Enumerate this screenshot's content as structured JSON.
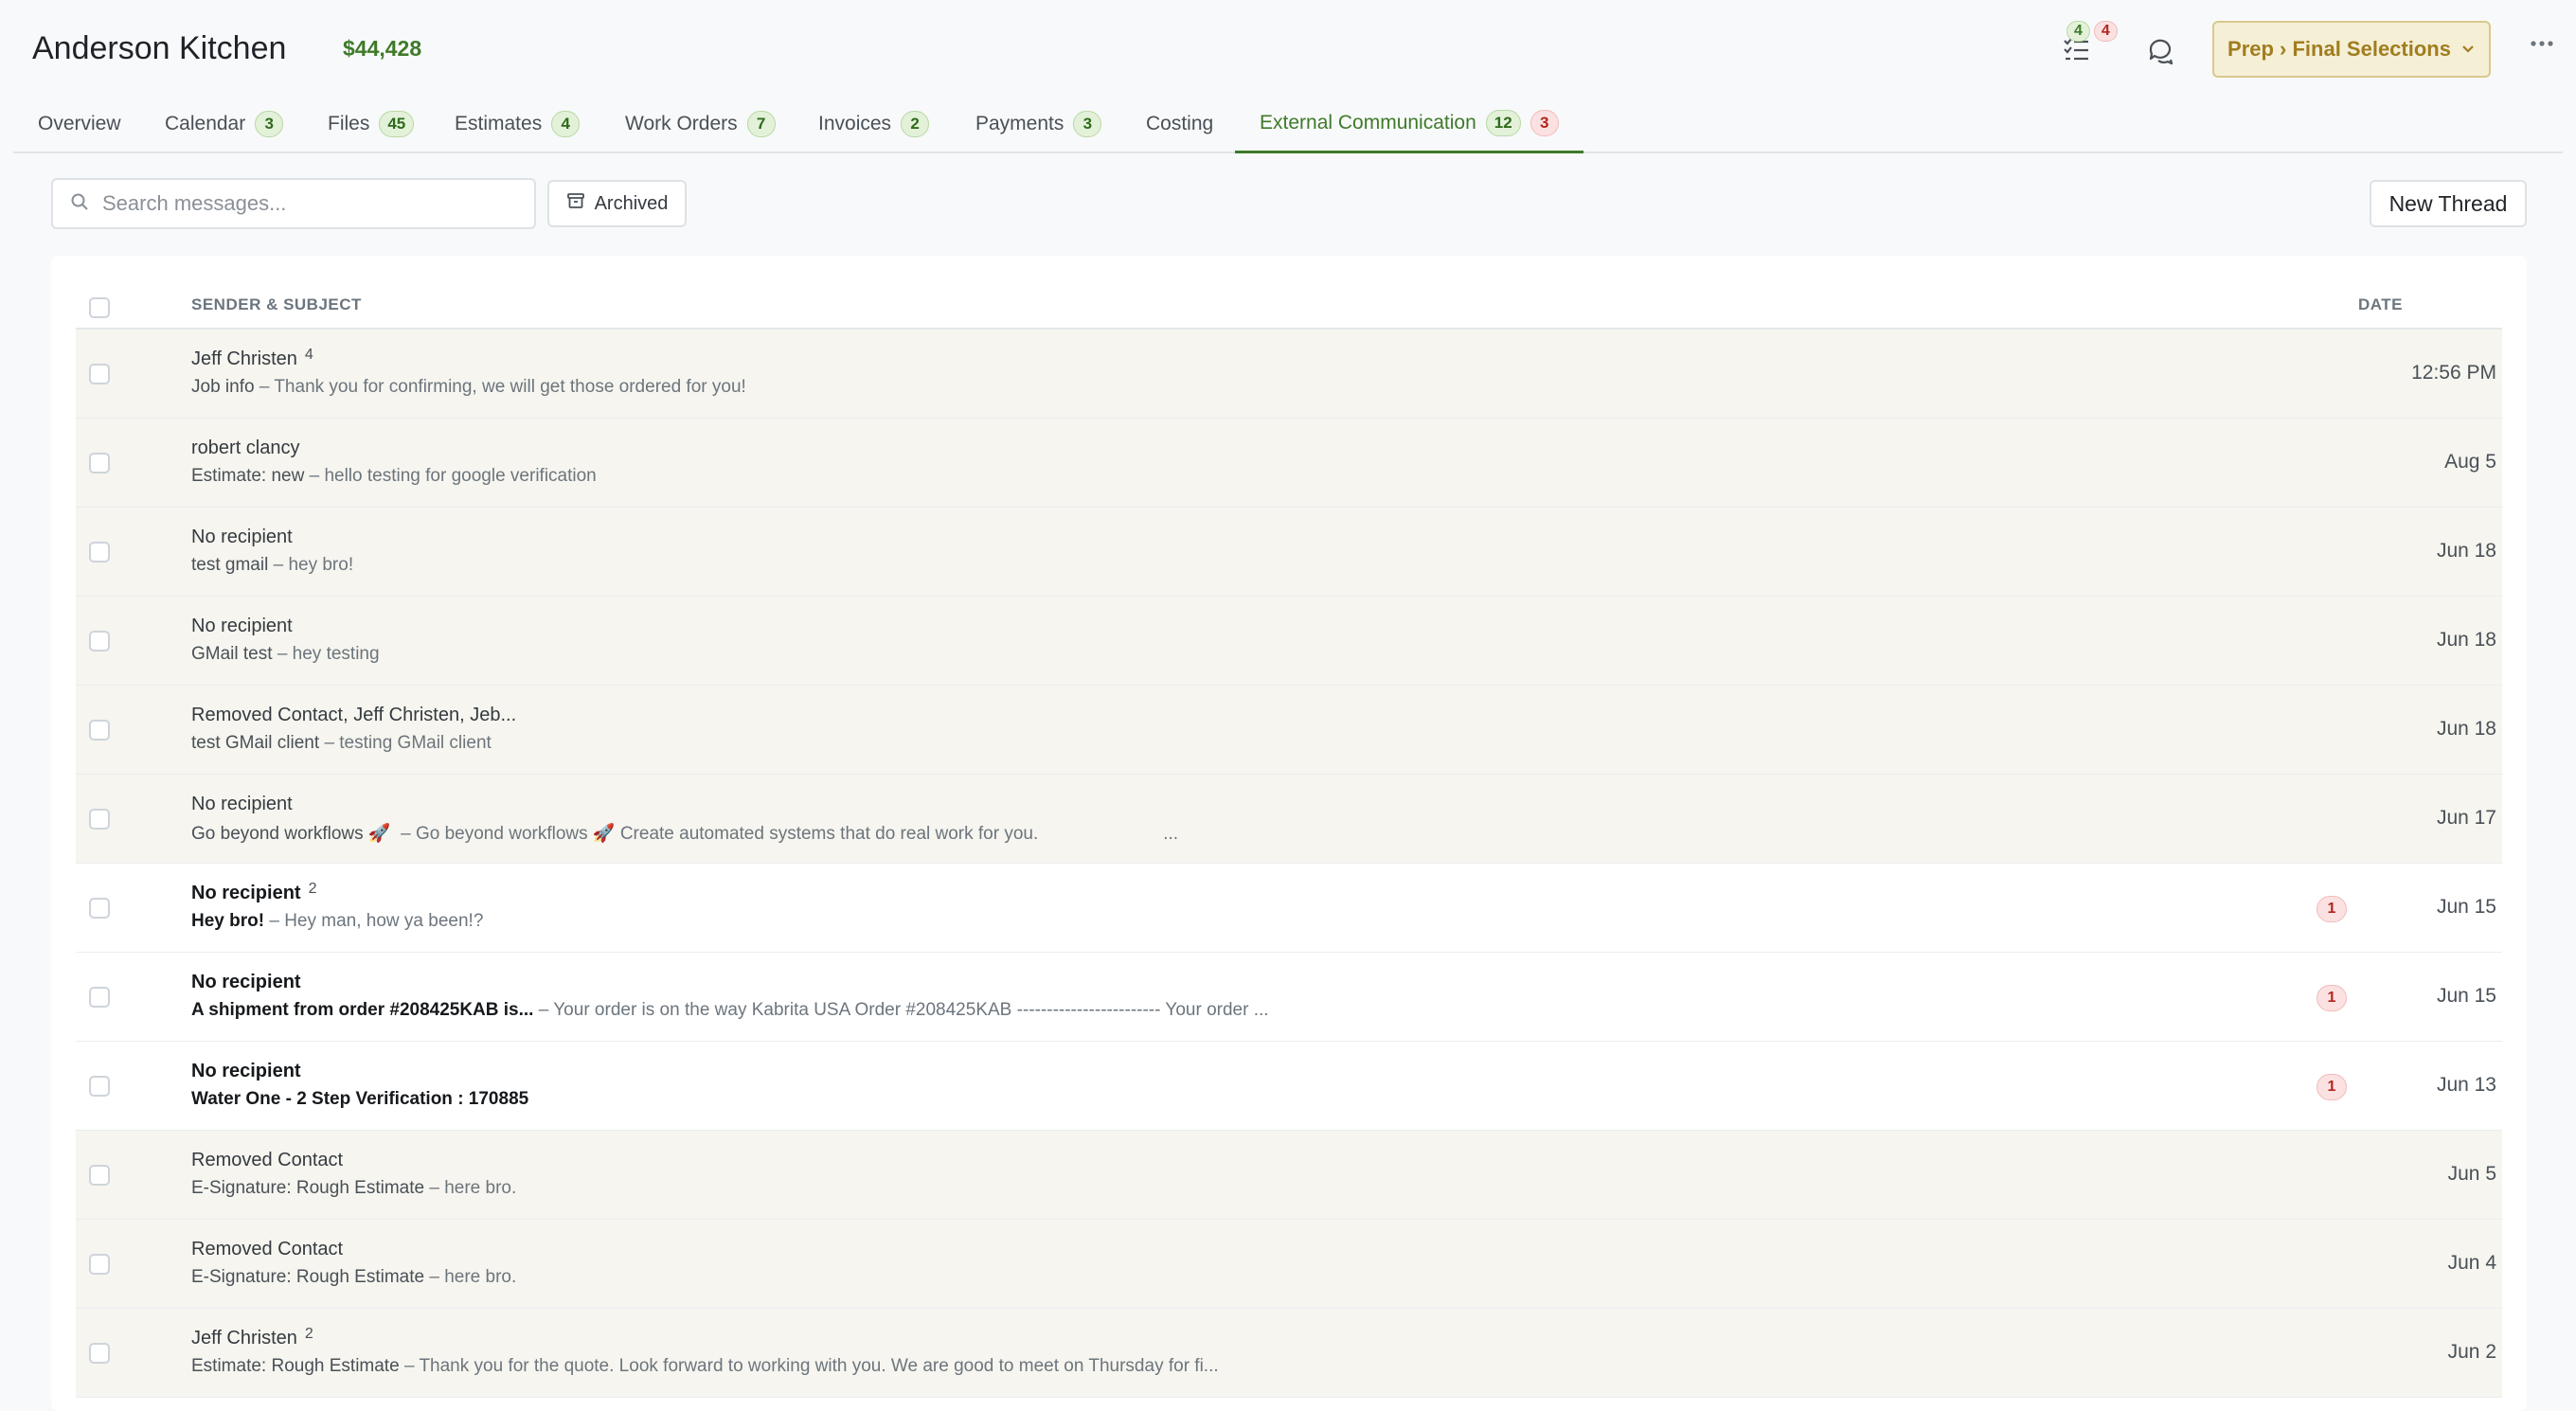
{
  "header": {
    "project_title": "Anderson Kitchen",
    "project_amount": "$44,428",
    "task_badges": {
      "done": "4",
      "pending": "4"
    },
    "stage_label": "Prep › Final Selections",
    "icons": [
      "tasks-icon",
      "chat-icon",
      "chevron-down-icon",
      "more-icon"
    ]
  },
  "tabs": [
    {
      "label": "Overview",
      "count": ""
    },
    {
      "label": "Calendar",
      "count": "3"
    },
    {
      "label": "Files",
      "count": "45"
    },
    {
      "label": "Estimates",
      "count": "4"
    },
    {
      "label": "Work Orders",
      "count": "7"
    },
    {
      "label": "Invoices",
      "count": "2"
    },
    {
      "label": "Payments",
      "count": "3"
    },
    {
      "label": "Costing",
      "count": ""
    },
    {
      "label": "External Communication",
      "count": "12",
      "alert_count": "3",
      "active": true
    }
  ],
  "toolbar": {
    "search_placeholder": "Search messages...",
    "search_value": "",
    "archived_label": "Archived",
    "new_thread_label": "New Thread"
  },
  "table": {
    "columns": {
      "sender": "SENDER & SUBJECT",
      "date": "DATE"
    },
    "rows": [
      {
        "sender": "Jeff Christen",
        "thread_count": "4",
        "subject": "Job info ",
        "preview": " – Thank you for confirming, we will get those ordered for you!",
        "unread": "",
        "date": "12:56 PM"
      },
      {
        "sender": "robert clancy",
        "thread_count": "",
        "subject": "Estimate: new ",
        "preview": " – hello testing for google verification",
        "unread": "",
        "date": "Aug 5"
      },
      {
        "sender": "No recipient",
        "thread_count": "",
        "subject": "test gmail ",
        "preview": " – hey bro!",
        "unread": "",
        "date": "Jun 18"
      },
      {
        "sender": "No recipient",
        "thread_count": "",
        "subject": "GMail test ",
        "preview": " – hey testing",
        "unread": "",
        "date": "Jun 18"
      },
      {
        "sender": "Removed Contact, Jeff Christen, Jeb...",
        "thread_count": "",
        "subject": "test GMail client ",
        "preview": " – testing GMail client",
        "unread": "",
        "date": "Jun 18"
      },
      {
        "sender": "No recipient",
        "thread_count": "",
        "subject": "Go beyond workflows 🚀 ",
        "preview": " – Go beyond workflows 🚀 Create automated systems that do real work for you.                         ...",
        "unread": "",
        "date": "Jun 17"
      },
      {
        "sender": "No recipient",
        "thread_count": "2",
        "subject": "Hey bro! ",
        "preview": " – Hey man, how ya been!?",
        "unread": "1",
        "date": "Jun 15"
      },
      {
        "sender": "No recipient",
        "thread_count": "",
        "subject": "A shipment from order #208425KAB is... ",
        "preview": " – Your order is on the way Kabrita USA Order #208425KAB ------------------------ Your order ...",
        "unread": "1",
        "date": "Jun 15"
      },
      {
        "sender": "No recipient",
        "thread_count": "",
        "subject": "Water One - 2 Step Verification : 170885",
        "preview": "",
        "unread": "1",
        "date": "Jun 13"
      },
      {
        "sender": "Removed Contact",
        "thread_count": "",
        "subject": "E-Signature: Rough Estimate ",
        "preview": " – here bro.",
        "unread": "",
        "date": "Jun 5"
      },
      {
        "sender": "Removed Contact",
        "thread_count": "",
        "subject": "E-Signature: Rough Estimate ",
        "preview": " – here bro.",
        "unread": "",
        "date": "Jun 4"
      },
      {
        "sender": "Jeff Christen",
        "thread_count": "2",
        "subject": "Estimate: Rough Estimate ",
        "preview": " – Thank you for the quote. Look forward to working with you. We are good to meet on Thursday for fi...",
        "unread": "",
        "date": "Jun 2"
      }
    ]
  },
  "colors": {
    "accent_green": "#3f7a2a",
    "alert_red": "#b3261e",
    "stage_gold": "#a07d1e",
    "read_row_bg": "#f6f5ef"
  }
}
